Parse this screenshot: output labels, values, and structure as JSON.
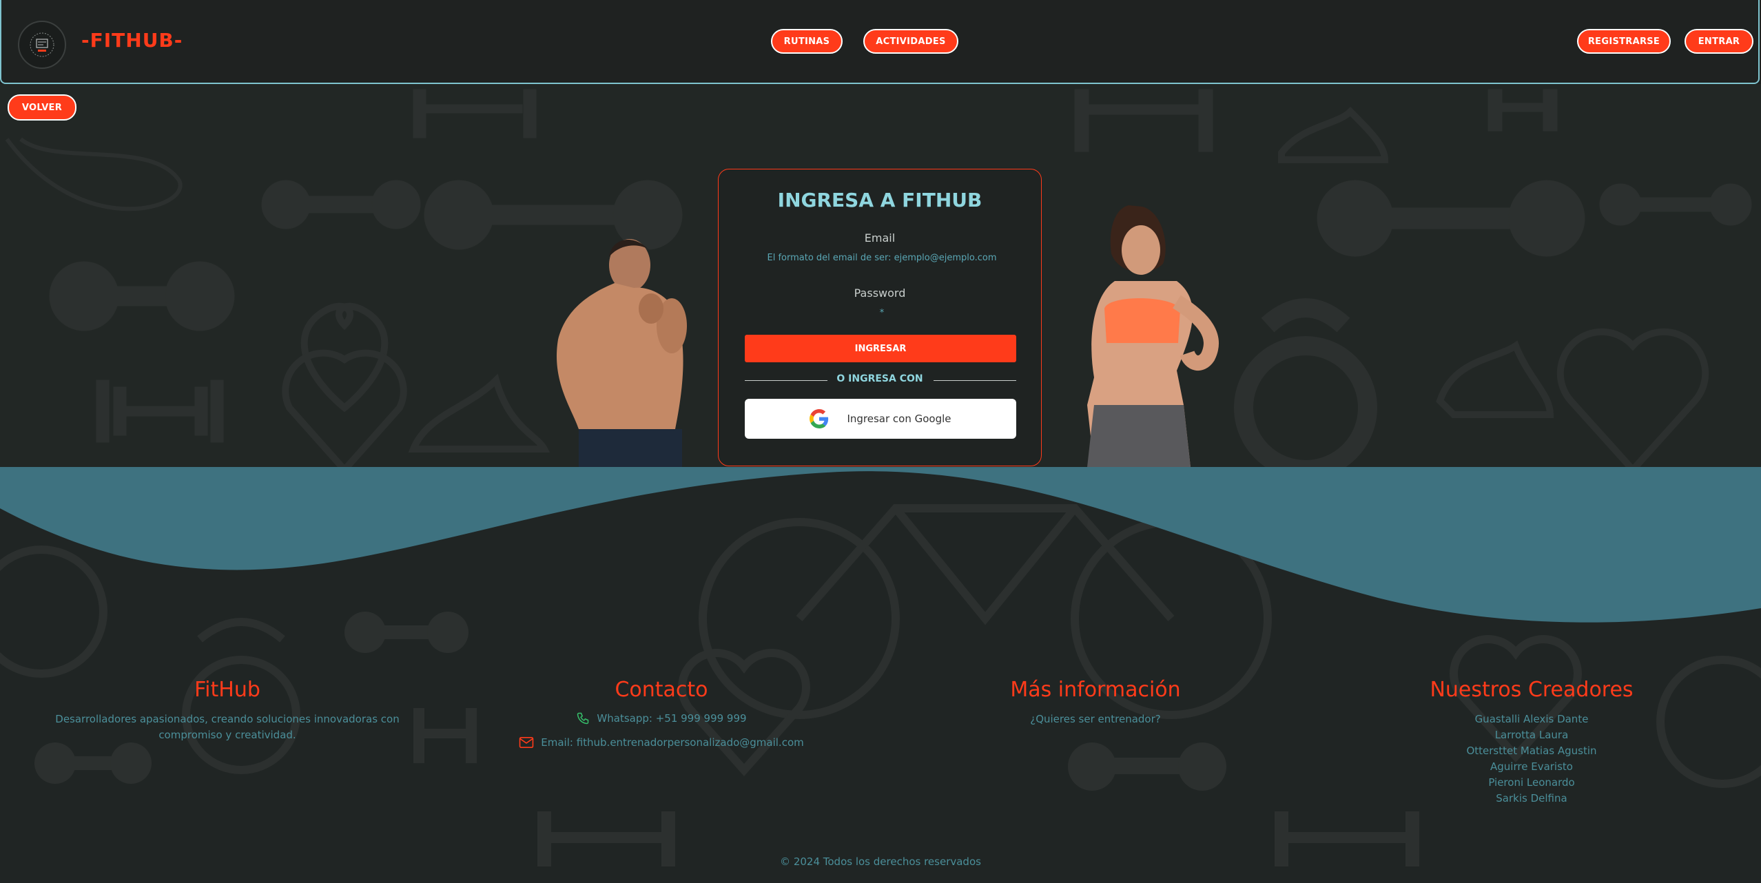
{
  "header": {
    "brand": "-FITHUB-",
    "nav": {
      "rutinas": "RUTINAS",
      "actividades": "ACTIVIDADES"
    },
    "auth": {
      "register": "REGISTRARSE",
      "login": "ENTRAR"
    }
  },
  "back_button": "VOLVER",
  "login": {
    "title": "INGRESA A FITHUB",
    "email_label": "Email",
    "email_placeholder": "El formato del email de ser: ejemplo@ejemplo.com",
    "password_label": "Password",
    "password_placeholder": "*",
    "submit": "INGRESAR",
    "divider": "O INGRESA CON",
    "google": "Ingresar con Google"
  },
  "footer": {
    "about": {
      "title": "FitHub",
      "text": "Desarrolladores apasionados, creando soluciones innovadoras con compromiso y creatividad."
    },
    "contact": {
      "title": "Contacto",
      "whatsapp": "Whatsapp: +51 999 999 999",
      "email": "Email: fithub.entrenadorpersonalizado@gmail.com"
    },
    "info": {
      "title": "Más información",
      "link": "¿Quieres ser entrenador?"
    },
    "creators": {
      "title": "Nuestros Creadores",
      "names": [
        "Guastalli Alexis Dante",
        "Larrotta Laura",
        "Ottersttet Matias Agustin",
        "Aguirre Evaristo",
        "Pieroni Leonardo",
        "Sarkis Delfina"
      ]
    },
    "copyright": "© 2024 Todos los derechos reservados"
  },
  "colors": {
    "accent": "#ff3b1a",
    "teal": "#8fd6df",
    "wave": "#3e7280"
  },
  "icons": [
    "logo-icon",
    "google-icon",
    "phone-icon",
    "mail-icon"
  ]
}
